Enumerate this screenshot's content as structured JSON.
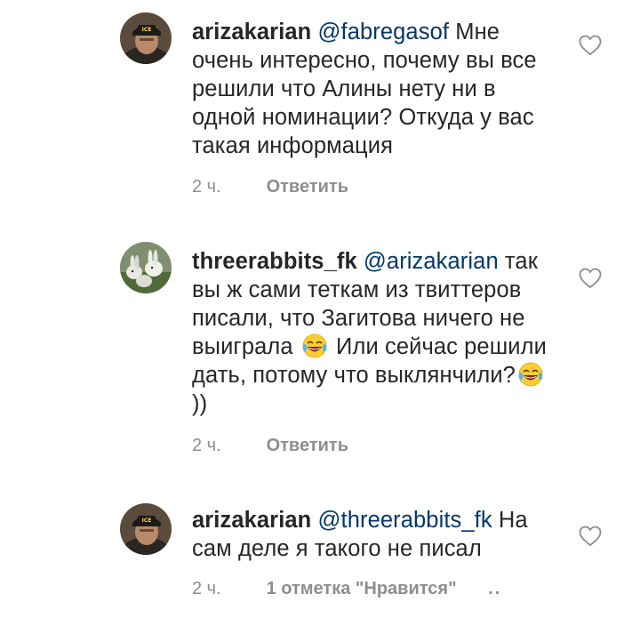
{
  "comments": [
    {
      "username": "arizakarian",
      "mention": "@fabregasof",
      "text": "Мне очень интересно, почему вы все решили что Алины нету ни в одной номинации? Откуда у вас такая информация",
      "time": "2 ч.",
      "reply_label": "Ответить",
      "avatar_icon": "user-avatar-icon",
      "avatar_badge": "ICE"
    },
    {
      "username": "threerabbits_fk",
      "mention": "@arizakarian",
      "text_part1": "так вы ж сами теткам из твиттеров писали, что Загитова ничего не выиграла",
      "text_part2": "Или сейчас решили дать, потому что выклянчили?",
      "text_part3": "))",
      "emoji_icon": "face-with-tears-of-joy-icon",
      "time": "2 ч.",
      "reply_label": "Ответить",
      "avatar_icon": "rabbits-avatar-icon"
    },
    {
      "username": "arizakarian",
      "mention": "@threerabbits_fk",
      "text": "На сам деле я такого не писал",
      "time": "2 ч.",
      "likes_label": "1 отметка \"Нравится\"",
      "more_label": "..",
      "avatar_icon": "user-avatar-icon",
      "avatar_badge": "ICE"
    }
  ],
  "colors": {
    "text": "#262626",
    "mention": "#00376b",
    "meta": "#8e8e8e",
    "heart_outline": "#8e8e8e",
    "emoji_yellow": "#ffcc33",
    "emoji_tears": "#4fb3f6"
  }
}
